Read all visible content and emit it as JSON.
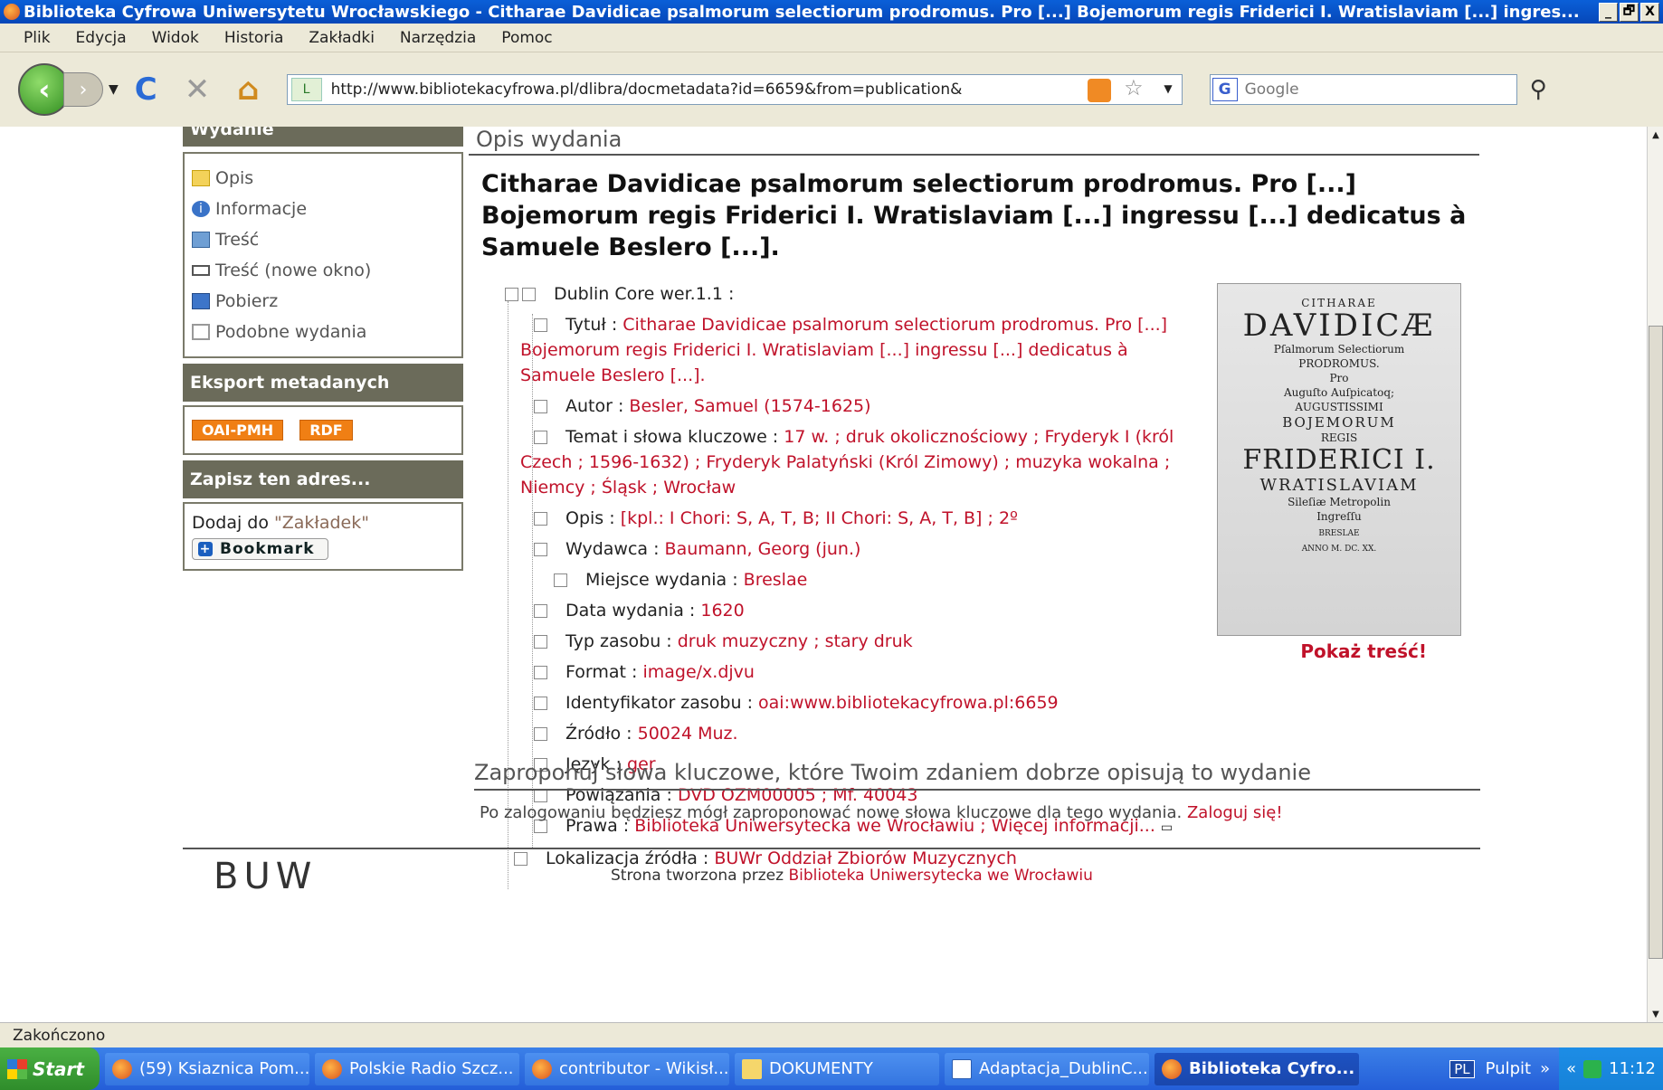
{
  "window": {
    "title": "Biblioteka Cyfrowa Uniwersytetu Wrocławskiego - Citharae Davidicae psalmorum selectiorum prodromus. Pro [...] Bojemorum regis Friderici I. Wratislaviam [...] ingres...",
    "buttons": [
      "_",
      "🗗",
      "X"
    ]
  },
  "menu": [
    "Plik",
    "Edycja",
    "Widok",
    "Historia",
    "Zakładki",
    "Narzędzia",
    "Pomoc"
  ],
  "url": "http://www.bibliotekacyfrowa.pl/dlibra/docmetadata?id=6659&from=publication&",
  "search_placeholder": "Google",
  "sidebar": {
    "wydanie_header": "Wydanie",
    "items": [
      "Opis",
      "Informacje",
      "Treść",
      "Treść (nowe okno)",
      "Pobierz",
      "Podobne wydania"
    ],
    "export_header": "Eksport metadanych",
    "export_buttons": [
      "OAI-PMH",
      "RDF"
    ],
    "save_header": "Zapisz ten adres...",
    "dodaj_prefix": "Dodaj do ",
    "dodaj_link": "\"Zakładek\"",
    "bookmark": "Bookmark"
  },
  "main": {
    "section_title": "Opis wydania",
    "doc_title": "Citharae Davidicae psalmorum selectiorum prodromus. Pro [...] Bojemorum regis Friderici I. Wratislaviam [...] ingressu [...] dedicatus à Samuele Beslero [...].",
    "dublin_core": "Dublin Core wer.1.1 :",
    "fields": [
      {
        "label": "Tytuł :",
        "value": "Citharae Davidicae psalmorum selectiorum prodromus. Pro [...] Bojemorum regis Friderici I. Wratislaviam [...] ingressu [...] dedicatus à Samuele Beslero [...]."
      },
      {
        "label": "Autor :",
        "value": "Besler, Samuel (1574-1625)"
      },
      {
        "label": "Temat i słowa kluczowe :",
        "value": "17 w. ; druk okolicznościowy ; Fryderyk I (król Czech ; 1596-1632) ; Fryderyk Palatyński (Król Zimowy) ; muzyka wokalna ; Niemcy ; Śląsk ; Wrocław"
      },
      {
        "label": "Opis :",
        "value": "[kpl.: I Chori: S, A, T, B; II Chori: S, A, T, B] ; 2º"
      },
      {
        "label": "Wydawca :",
        "value": "Baumann, Georg (jun.)"
      },
      {
        "label": "Miejsce wydania :",
        "value": "Breslae"
      },
      {
        "label": "Data wydania :",
        "value": "1620"
      },
      {
        "label": "Typ zasobu :",
        "value": "druk muzyczny ; stary druk"
      },
      {
        "label": "Format :",
        "value": "image/x.djvu"
      },
      {
        "label": "Identyfikator zasobu :",
        "value": "oai:www.bibliotekacyfrowa.pl:6659"
      },
      {
        "label": "Źródło :",
        "value": "50024 Muz."
      },
      {
        "label": "Język :",
        "value": "ger"
      },
      {
        "label": "Powiązania :",
        "value": "DVD OZM00005 ; Mf. 40043"
      },
      {
        "label": "Prawa :",
        "value": "Biblioteka Uniwersytecka we Wrocławiu ; Więcej informacji..."
      }
    ],
    "lokalizacja_label": "Lokalizacja źródła :",
    "lokalizacja_value": "BUWr Oddział Zbiorów Muzycznych",
    "cover_lines": [
      "CITHARAE",
      "DAVIDICÆ",
      "Pſalmorum Selectiorum",
      "PRODROMUS.",
      "Pro",
      "Auguſto Auſpicatoq;",
      "AUGUSTISSIMI",
      "BOJEMORUM",
      "REGIS",
      "FRIDERICI I.",
      "WRATISLAVIAM",
      "Sileſiæ Metropolin",
      "Ingreſſu",
      "BRESLAE",
      "ANNO M. DC. XX."
    ],
    "pokaz": "Pokaż treść!",
    "zaproponuj": "Zaproponuj słowa kluczowe, które Twoim zdaniem dobrze opisują to wydanie",
    "logged_text": "Po zalogowaniu będziesz mógł zaproponować nowe słowa kluczowe dla tego wydania.",
    "login_link": "Zaloguj się!",
    "footer_logo": "BUW",
    "footer_text": "Strona tworzona przez ",
    "footer_link": "Biblioteka Uniwersytecka we Wrocławiu"
  },
  "status": "Zakończono",
  "taskbar": {
    "start": "Start",
    "tasks": [
      "(59) Ksiaznica Pom...",
      "Polskie Radio Szcz...",
      "contributor - Wikisł...",
      "DOKUMENTY",
      "Adaptacja_DublinC...",
      "Biblioteka Cyfro..."
    ],
    "lang": "PL",
    "pulpit": "Pulpit",
    "time": "11:12"
  }
}
